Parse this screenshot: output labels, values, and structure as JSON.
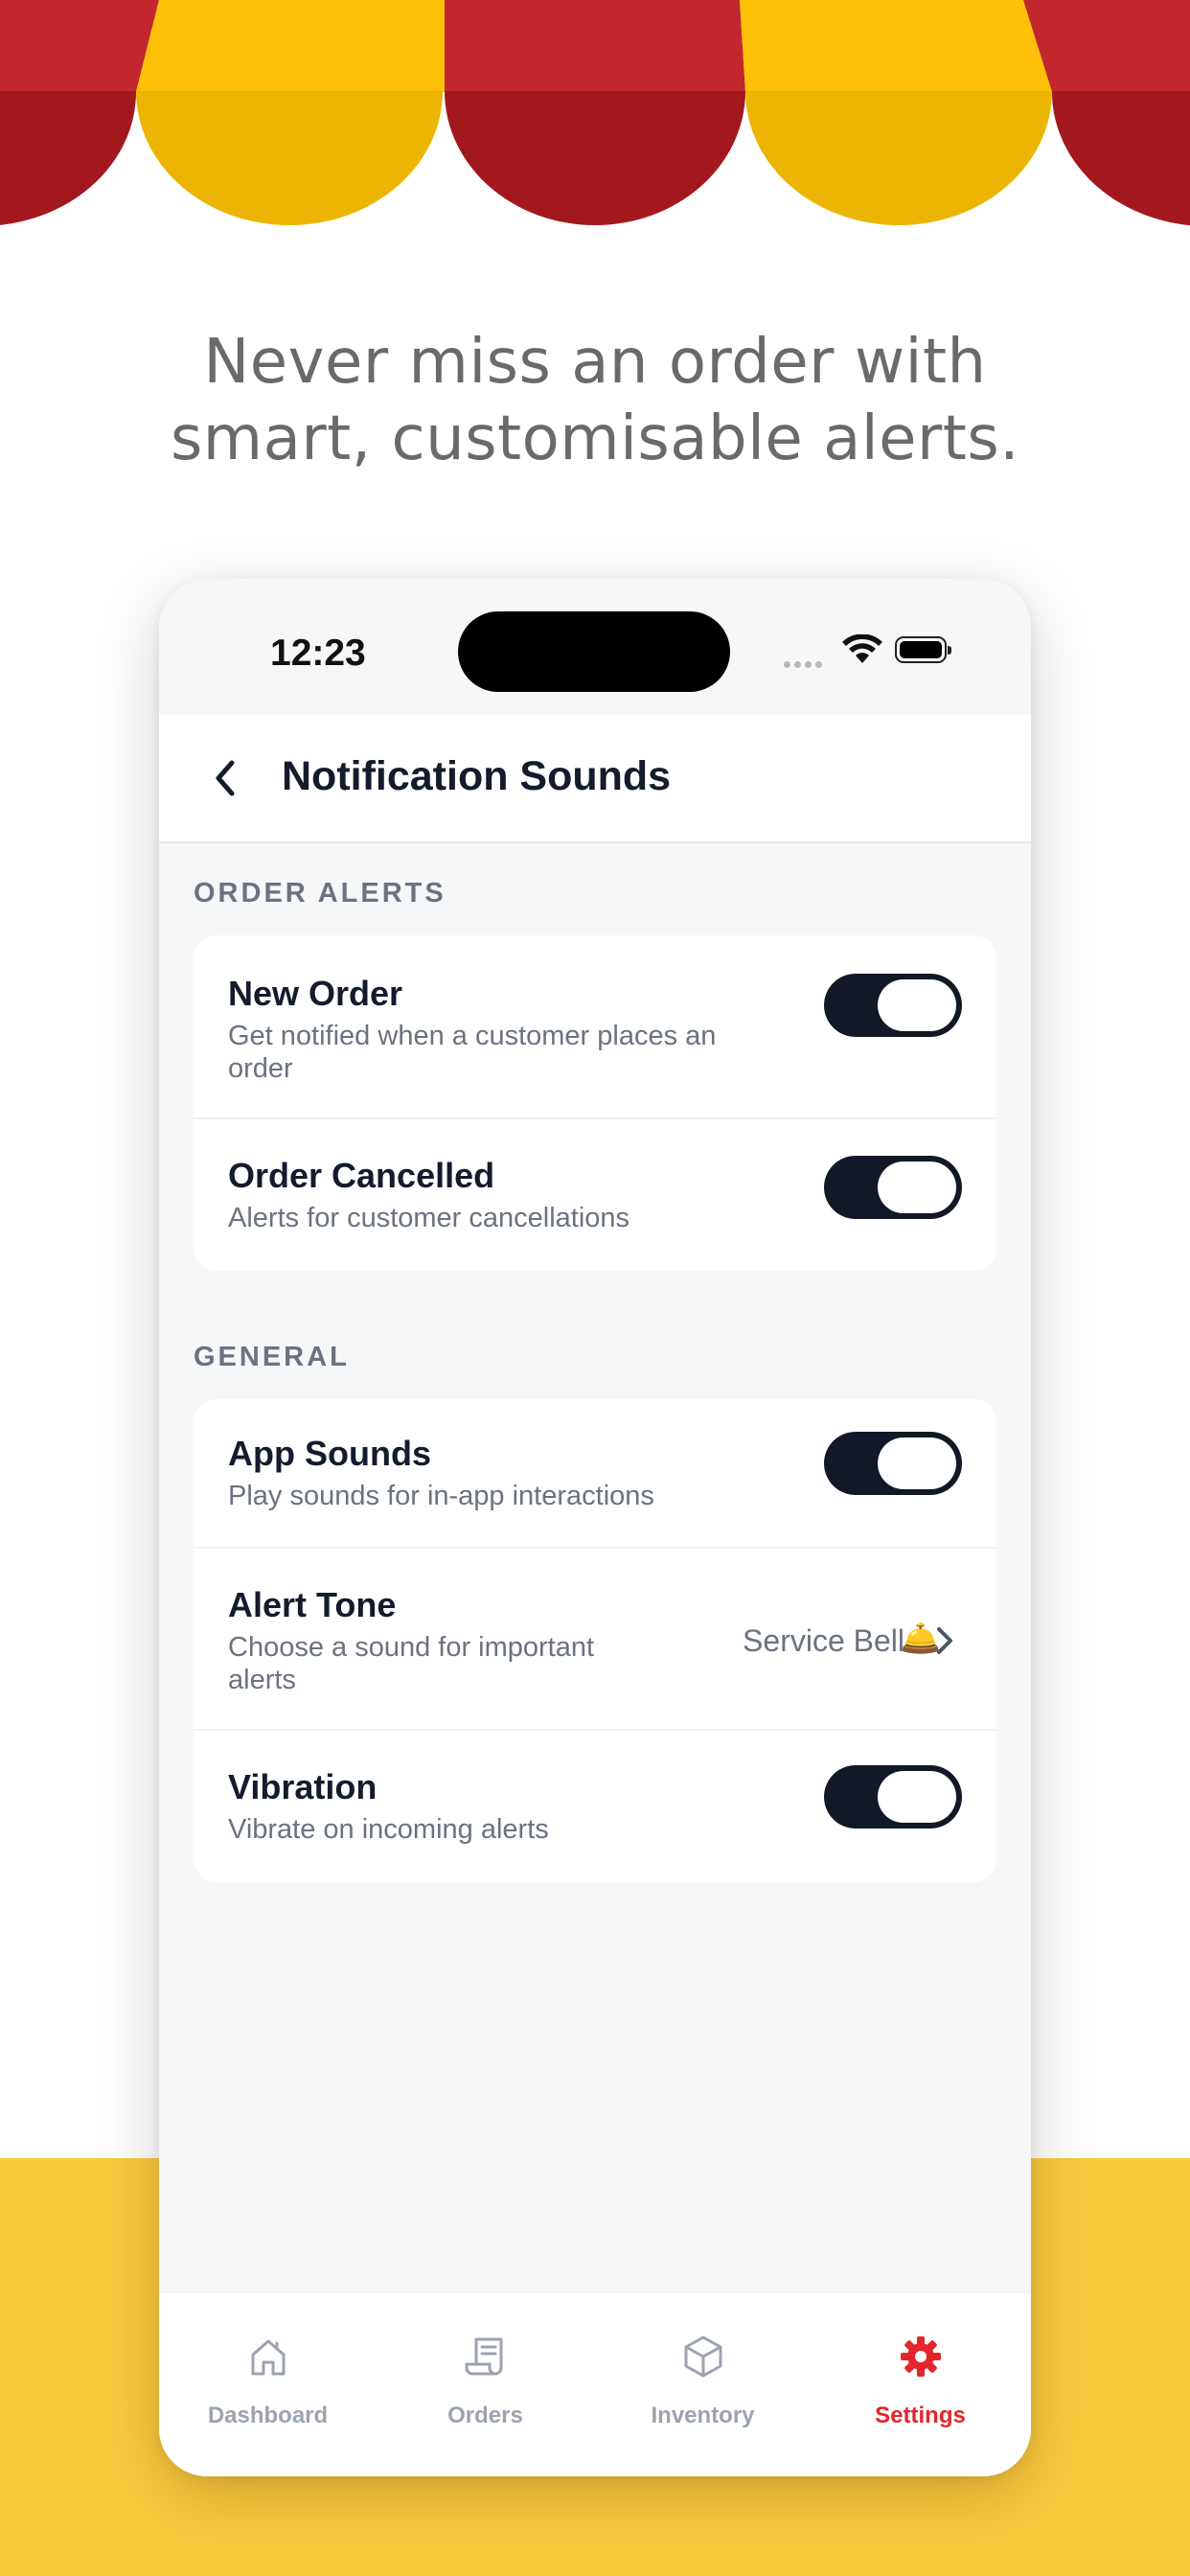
{
  "headline": {
    "line1": "Never miss an order with",
    "line2": "smart, customisable alerts."
  },
  "colors": {
    "awning_red": "#C1272D",
    "awning_red_dark": "#A3181E",
    "awning_yellow": "#FFC107",
    "awning_yellow_dark": "#ECB503",
    "bottom_band": "#FBC93D",
    "toggle_on": "#121826",
    "accent": "#E3262B"
  },
  "status_bar": {
    "time": "12:23",
    "icons": [
      "signal-icon",
      "wifi-icon",
      "battery-icon"
    ]
  },
  "header": {
    "back_icon": "chevron-left-icon",
    "title": "Notification Sounds"
  },
  "sections": {
    "order_alerts": {
      "label": "ORDER ALERTS",
      "items": [
        {
          "title": "New Order",
          "subtitle": "Get notified when a customer places an order",
          "toggle_on": true
        },
        {
          "title": "Order Cancelled",
          "subtitle": "Alerts for customer cancellations",
          "toggle_on": true
        }
      ]
    },
    "general": {
      "label": "GENERAL",
      "items": [
        {
          "title": "App Sounds",
          "subtitle": "Play sounds for in-app interactions",
          "toggle_on": true
        },
        {
          "title": "Alert Tone",
          "subtitle": "Choose a sound for important alerts",
          "value": "Service Bell",
          "value_emoji": "🛎️"
        },
        {
          "title": "Vibration",
          "subtitle": "Vibrate on incoming alerts",
          "toggle_on": true
        }
      ]
    }
  },
  "tabs": [
    {
      "label": "Dashboard",
      "icon": "home-icon",
      "active": false
    },
    {
      "label": "Orders",
      "icon": "receipt-icon",
      "active": false
    },
    {
      "label": "Inventory",
      "icon": "box-icon",
      "active": false
    },
    {
      "label": "Settings",
      "icon": "gear-icon",
      "active": true
    }
  ]
}
